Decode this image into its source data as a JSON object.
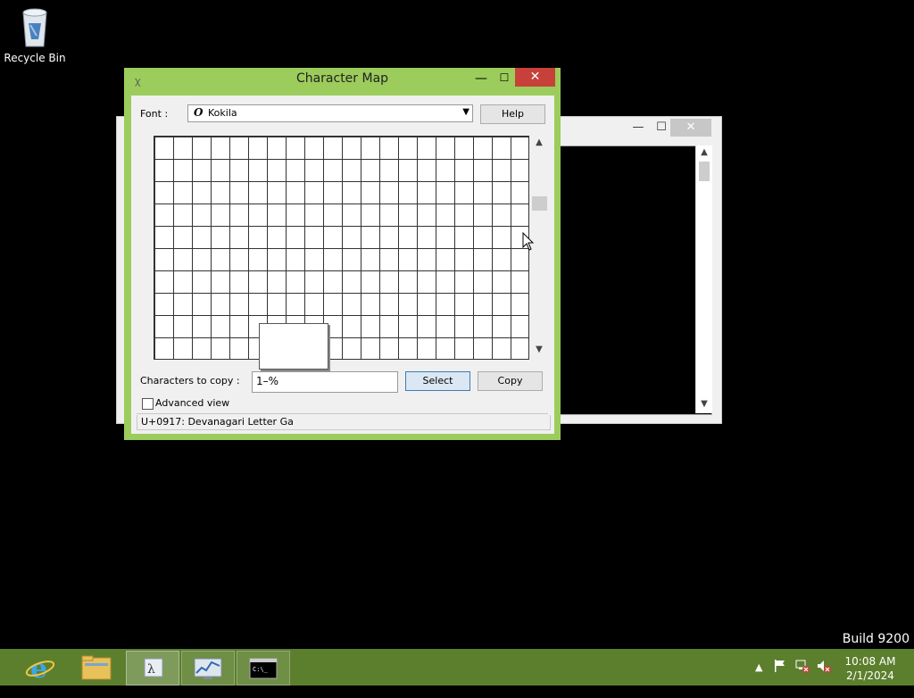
{
  "desktop": {
    "recycle_bin_label": "Recycle Bin",
    "build_text": "Build 9200"
  },
  "background_window": {
    "minimize_glyph": "—",
    "maximize_glyph": "☐",
    "close_glyph": "✕"
  },
  "char_map": {
    "title": "Character Map",
    "minimize_glyph": "—",
    "maximize_glyph": "☐",
    "close_glyph": "✕",
    "font_label": "Font :",
    "font_value": "Kokila",
    "font_icon_glyph": "O",
    "help_label": "Help",
    "chars_to_copy_label": "Characters to copy :",
    "chars_to_copy_value": "1–%",
    "select_label": "Select",
    "copy_label": "Copy",
    "advanced_view_label": "Advanced view",
    "advanced_view_checked": false,
    "status_text": "U+0917: Devanagari Letter Ga"
  },
  "taskbar": {
    "items": [
      {
        "name": "internet-explorer",
        "state": "normal"
      },
      {
        "name": "file-explorer",
        "state": "normal"
      },
      {
        "name": "character-map",
        "state": "active"
      },
      {
        "name": "performance-monitor",
        "state": "open"
      },
      {
        "name": "command-prompt",
        "state": "open"
      }
    ],
    "clock_time": "10:08 AM",
    "clock_date": "2/1/2024"
  },
  "colors": {
    "accent": "#9ccc5b",
    "taskbar": "#5c7f2d",
    "close_button": "#c7403a"
  }
}
